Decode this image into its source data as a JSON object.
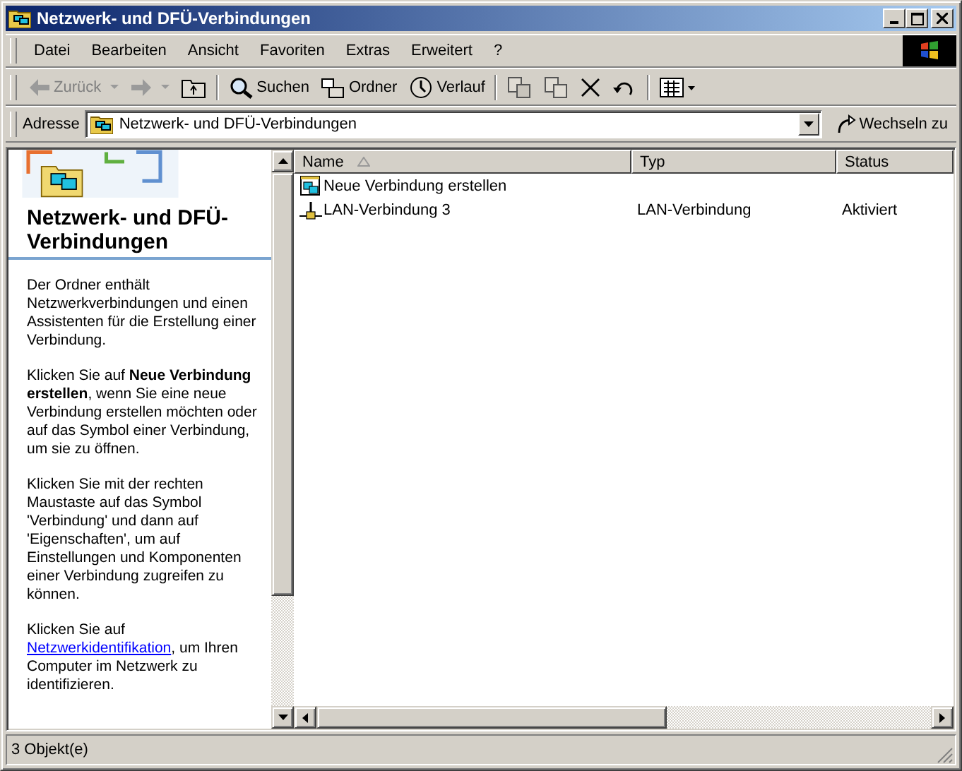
{
  "window": {
    "title": "Netzwerk- und DFÜ-Verbindungen"
  },
  "menu": [
    "Datei",
    "Bearbeiten",
    "Ansicht",
    "Favoriten",
    "Extras",
    "Erweitert",
    "?"
  ],
  "toolbar": [
    {
      "kind": "back",
      "label": "Zurück",
      "disabled": true
    },
    {
      "kind": "forward",
      "disabled": true
    },
    {
      "kind": "up"
    },
    {
      "kind": "search",
      "label": "Suchen"
    },
    {
      "kind": "folders",
      "label": "Ordner"
    },
    {
      "kind": "history",
      "label": "Verlauf"
    },
    {
      "kind": "moveto"
    },
    {
      "kind": "copyto"
    },
    {
      "kind": "delete"
    },
    {
      "kind": "undo"
    },
    {
      "kind": "views"
    }
  ],
  "address": {
    "label": "Adresse",
    "value": "Netzwerk- und DFÜ-Verbindungen",
    "go": "Wechseln zu"
  },
  "info_pane": {
    "title": "Netzwerk- und DFÜ-Verbindungen",
    "paragraphs": [
      {
        "text": "Der Ordner enthält Netzwerkverbindungen und einen Assistenten für die Erstellung einer Verbindung."
      },
      {
        "text": "Klicken Sie auf **Neue Verbindung erstellen**, wenn Sie eine neue Verbindung erstellen möchten oder auf das Symbol einer Verbindung, um sie zu öffnen."
      },
      {
        "text": "Klicken Sie mit der rechten Maustaste auf das Symbol 'Verbindung' und dann auf 'Eigenschaften', um auf Einstellungen und Komponenten einer Verbindung zugreifen zu können."
      },
      {
        "text": "Klicken Sie auf",
        "link": "Netzwerkidentifikation",
        "after": ", um Ihren Computer im Netzwerk zu identifizieren."
      }
    ]
  },
  "table": {
    "columns": [
      {
        "label": "Name",
        "sorted": true
      },
      {
        "label": "Typ",
        "sorted": false
      },
      {
        "label": "Status",
        "sorted": false
      }
    ],
    "rows": [
      {
        "kind": "wizard",
        "name": "Neue Verbindung erstellen",
        "type": "",
        "status": ""
      },
      {
        "kind": "lan",
        "name": "LAN-Verbindung 3",
        "type": "LAN-Verbindung",
        "status": "Aktiviert"
      }
    ]
  },
  "status_bar": {
    "text": "3 Objekt(e)"
  }
}
